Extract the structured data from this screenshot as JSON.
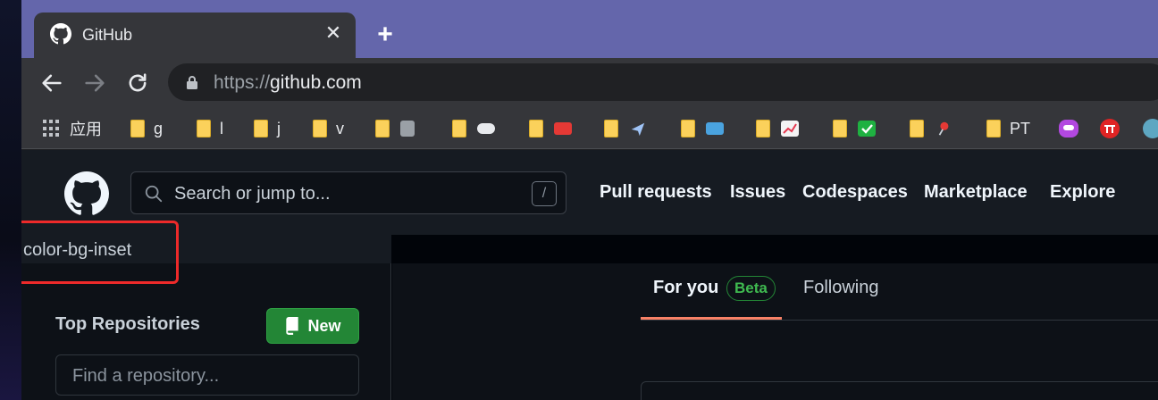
{
  "browser": {
    "tab_title": "GitHub",
    "close_glyph": "✕",
    "new_tab_glyph": "+",
    "url_scheme": "https://",
    "url_host": "github.com"
  },
  "bookmarks": {
    "apps_label": "应用",
    "items": [
      {
        "label": "g",
        "icon": "folder-icon"
      },
      {
        "label": "l",
        "icon": "folder-icon"
      },
      {
        "label": "j",
        "icon": "folder-icon"
      },
      {
        "label": "v",
        "icon": "folder-icon"
      },
      {
        "label": "",
        "icon": "folder-icon"
      },
      {
        "label": "",
        "icon": "folder-icon"
      },
      {
        "label": "",
        "icon": "folder-icon"
      },
      {
        "label": "",
        "icon": "folder-icon"
      },
      {
        "label": "",
        "icon": "folder-icon"
      },
      {
        "label": "",
        "icon": "folder-icon"
      },
      {
        "label": "",
        "icon": "folder-icon"
      },
      {
        "label": "",
        "icon": "folder-icon"
      },
      {
        "label": "",
        "icon": "folder-icon"
      },
      {
        "label": "PT",
        "icon": "folder-icon"
      }
    ]
  },
  "github": {
    "search_placeholder": "Search or jump to...",
    "search_shortcut": "/",
    "nav": [
      "Pull requests",
      "Issues",
      "Codespaces",
      "Marketplace",
      "Explore"
    ],
    "annotation": "color-bg-inset",
    "top_repositories": "Top Repositories",
    "new_button": "New",
    "find_repo_placeholder": "Find a repository...",
    "tab_for_you": "For you",
    "beta_badge": "Beta",
    "tab_following": "Following"
  },
  "colors": {
    "tabstrip": "#6466ab",
    "annotation_border": "#ee2a2a",
    "new_button": "#238636",
    "tab_underline": "#f78166"
  }
}
